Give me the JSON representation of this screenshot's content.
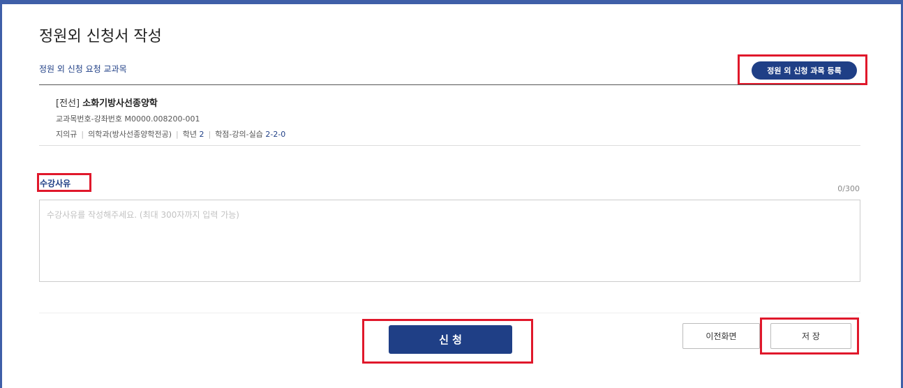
{
  "page": {
    "title": "정원외 신청서 작성"
  },
  "section": {
    "label": "정원 외 신청 요청 교과목",
    "register_button": "정원 외 신청 과목 등록"
  },
  "course": {
    "tag": "[전선]",
    "name": "소화기방사선종양학",
    "code": "교과목번호-강좌번호 M0000.008200-001",
    "professor": "지의규",
    "department": "의학과(방사선종양학전공)",
    "grade_label": "학년",
    "grade_value": "2",
    "credits_label": "학점-강의-실습",
    "credits_value": "2-2-0"
  },
  "reason": {
    "label": "수강사유",
    "counter": "0/300",
    "placeholder": "수강사유를 작성해주세요. (최대 300자까지 입력 가능)",
    "value": ""
  },
  "actions": {
    "apply": "신 청",
    "previous": "이전화면",
    "save": "저 장"
  },
  "colors": {
    "accent": "#1f3f86",
    "highlight": "#e0182b",
    "frame": "#3f5fa8"
  }
}
